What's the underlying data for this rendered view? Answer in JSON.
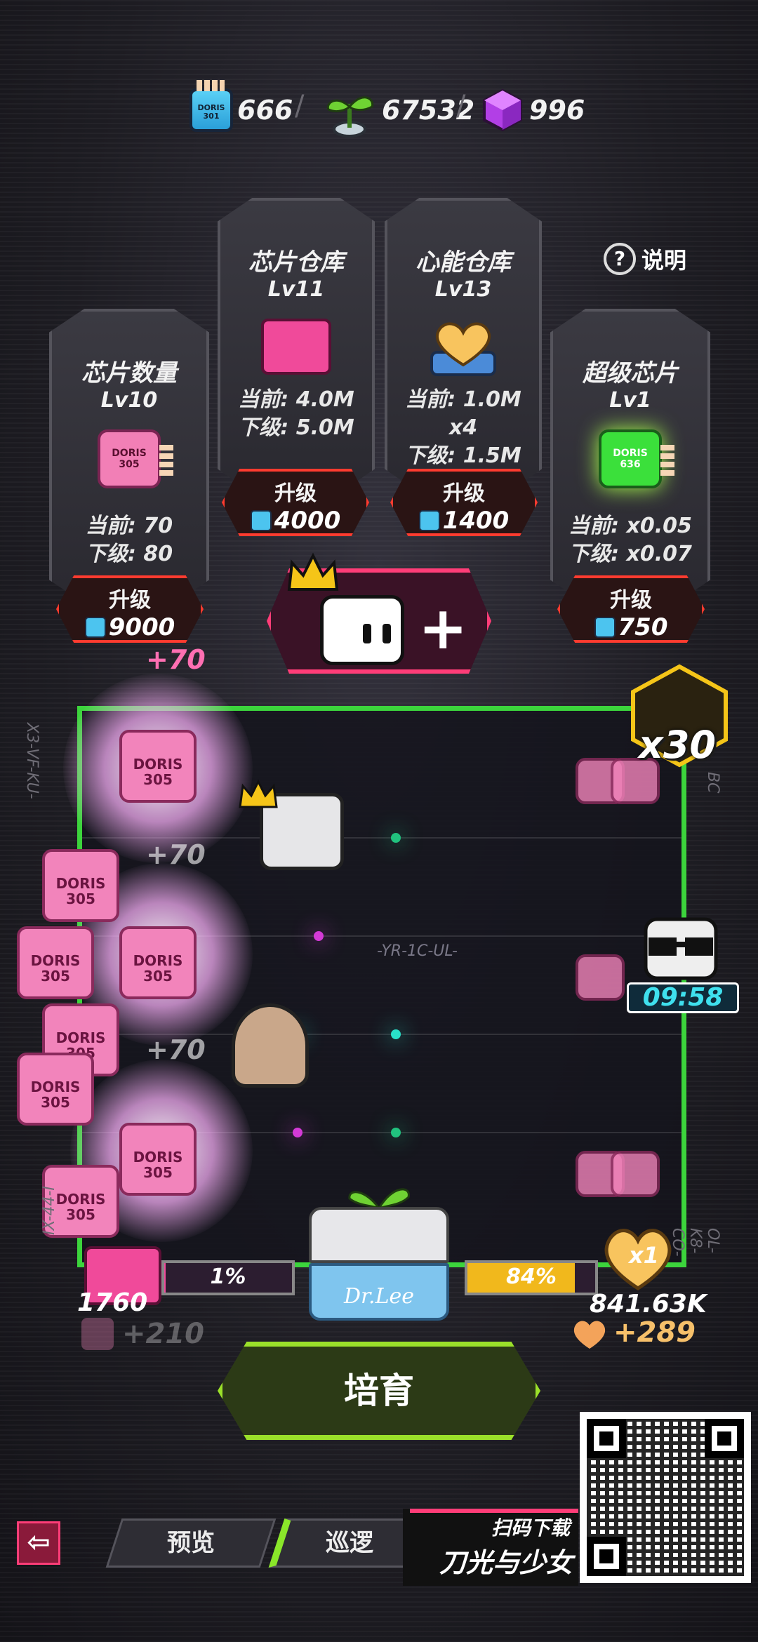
{
  "currency": {
    "chips": "666",
    "sprouts": "67532",
    "cubes": "996",
    "chip_icon_label": "DORIS 301",
    "separator": "/"
  },
  "help": {
    "icon": "question-icon",
    "label": "说明"
  },
  "panels": [
    {
      "title": "芯片数量",
      "level": "Lv10",
      "icon_label": "DORIS 305",
      "current": "当前: 70",
      "next": "下级: 80",
      "upgrade_label": "升级",
      "cost": "9000"
    },
    {
      "title": "芯片仓库",
      "level": "Lv11",
      "current": "当前: 4.0M",
      "next": "下级: 5.0M",
      "upgrade_label": "升级",
      "cost": "4000"
    },
    {
      "title": "心能仓库",
      "level": "Lv13",
      "current": "当前: 1.0M x4",
      "next": "下级: 1.5M x4",
      "upgrade_label": "升级",
      "cost": "1400"
    },
    {
      "title": "超级芯片",
      "level": "Lv1",
      "icon_label": "DORIS 636",
      "current": "当前: x0.05",
      "next": "下级: x0.07",
      "upgrade_label": "升级",
      "cost": "750"
    }
  ],
  "arena": {
    "float_top": "+70",
    "float_a": "+70",
    "float_b": "+70",
    "chip_label": "DORIS 305",
    "multiplier": "x30",
    "timer": "09:58",
    "lane_code_center": "-YR-1C-UL-",
    "side_left_top": "X3-VF-KU-",
    "side_left_bottom": "IX-44-I",
    "side_right_bottom": "OL-K8-CO-",
    "side_right_top": "BC"
  },
  "progress": {
    "left_pct": "1%",
    "left_fraction": 0.01,
    "right_pct": "84%",
    "right_fraction": 0.84,
    "chip_count": "1760",
    "chip_gain": "+210",
    "heart_mult": "x1",
    "heart_total": "841.63K",
    "heart_gain": "+289"
  },
  "incubator": {
    "label": "Dr.Lee"
  },
  "cultivate_button": "培育",
  "nav": {
    "back_icon": "arrow-left-icon",
    "tab_preview": "预览",
    "tab_patrol": "巡逻"
  },
  "promo": {
    "line1": "扫码下载",
    "line2": "刀光与少女"
  },
  "colors": {
    "accent_green": "#3cd43c",
    "accent_red": "#ff3b2f",
    "accent_pink": "#ff3d78",
    "progress_yellow": "#f1b81c",
    "timer_cyan": "#3fe0ee"
  }
}
